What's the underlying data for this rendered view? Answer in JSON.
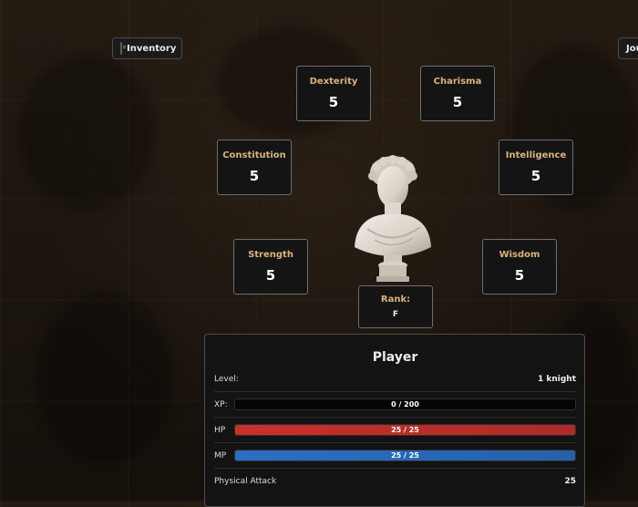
{
  "buttons": {
    "inventory": {
      "label": "Inventory",
      "icon": "book-icon"
    },
    "journal": {
      "label": "Jou",
      "icon": "book-icon"
    }
  },
  "stats": {
    "dexterity": {
      "label": "Dexterity",
      "value": "5"
    },
    "charisma": {
      "label": "Charisma",
      "value": "5"
    },
    "constitution": {
      "label": "Constitution",
      "value": "5"
    },
    "intelligence": {
      "label": "Intelligence",
      "value": "5"
    },
    "strength": {
      "label": "Strength",
      "value": "5"
    },
    "wisdom": {
      "label": "Wisdom",
      "value": "5"
    }
  },
  "rank": {
    "label": "Rank:",
    "value": "F"
  },
  "player": {
    "title": "Player",
    "level": {
      "label": "Level:",
      "value": "1 knight"
    },
    "xp": {
      "label": "XP:",
      "text": "0 / 200",
      "fraction": 0
    },
    "hp": {
      "label": "HP",
      "text": "25 / 25",
      "fraction": 1
    },
    "mp": {
      "label": "MP",
      "text": "25 / 25",
      "fraction": 1
    },
    "physical_attack": {
      "label": "Physical Attack",
      "value": "25"
    }
  },
  "colors": {
    "accent_label": "#d9b47a",
    "hp_bar": "#c8302d",
    "mp_bar": "#2a6fc4"
  }
}
